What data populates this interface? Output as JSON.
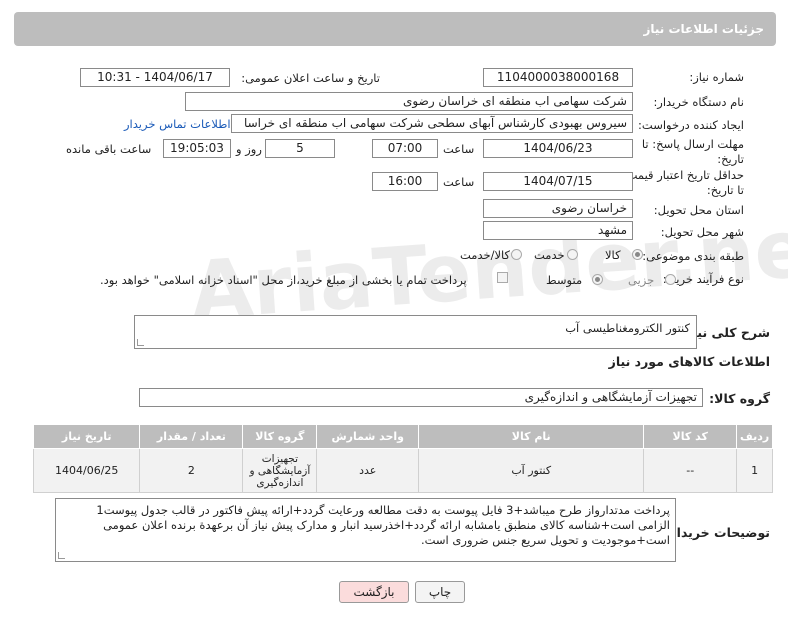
{
  "header": {
    "title": "جزئیات اطلاعات نیاز"
  },
  "fields": {
    "need_number_label": "شماره نیاز:",
    "need_number": "1104000038000168",
    "announce_label": "تاریخ و ساعت اعلان عمومی:",
    "announce_value": "1404/06/17 - 10:31",
    "buyer_org_label": "نام دستگاه خریدار:",
    "buyer_org": "شرکت سهامی اب منطقه ای خراسان رضوی",
    "creator_label": "ایجاد کننده درخواست:",
    "creator": "سیروس  بهبودی کارشناس آبهای سطحی شرکت سهامی اب منطقه ای خراسا",
    "contact_link": "اطلاعات تماس خریدار",
    "deadline_label_1": "مهلت ارسال پاسخ: تا",
    "deadline_label_2": "تاریخ:",
    "deadline_date": "1404/06/23",
    "time_label": "ساعت",
    "deadline_time": "07:00",
    "days_value": "5",
    "days_label": "روز و",
    "remaining_time": "19:05:03",
    "remaining_label": "ساعت باقی مانده",
    "price_valid_label_1": "حداقل تاریخ اعتبار قیمت:",
    "price_valid_label_2": "تا تاریخ:",
    "price_valid_date": "1404/07/15",
    "price_valid_time": "16:00",
    "province_label": "استان محل تحویل:",
    "province": "خراسان رضوی",
    "city_label": "شهر محل تحویل:",
    "city": "مشهد",
    "category_label": "طبقه بندی موضوعی:",
    "category_options": [
      "کالا",
      "خدمت",
      "کالا/خدمت"
    ],
    "process_label": "نوع فرآیند خرید :",
    "process_options": [
      "جزیی",
      "متوسط"
    ],
    "payment_note": "پرداخت تمام یا بخشی از مبلغ خرید،از محل \"اسناد خزانه اسلامی\" خواهد بود.",
    "general_desc_label": "شرح کلی نیاز:",
    "general_desc": "کنتور الکترومغناطیسی آب",
    "goods_info_label": "اطلاعات کالاهای مورد نیاز",
    "goods_group_label": "گروه کالا:",
    "goods_group": "تجهیزات آزمایشگاهی و اندازه‌گیری",
    "buyer_notes_label": "توضیحات خریدار:",
    "buyer_notes": "پرداخت مدتدارواز طرح میباشد+3 فایل پیوست به دقت مطالعه ورعایت گردد+ارائه پیش فاکتور در قالب جدول پیوست1 الزامی است+شناسه کالای منطبق یامشابه ارائه گردد+اخذرسید انبار و مدارک پیش نیاز آن برعهدة برنده اعلان عمومی است+موجودیت و تحویل سریع جنس ضروری است."
  },
  "table": {
    "headers": [
      "ردیف",
      "کد کالا",
      "نام کالا",
      "واحد شمارش",
      "گروه کالا",
      "تعداد / مقدار",
      "تاریخ نیاز"
    ],
    "rows": [
      [
        "1",
        "--",
        "کنتور آب",
        "عدد",
        "تجهیزات آزمایشگاهی و اندازه‌گیری",
        "2",
        "1404/06/25"
      ]
    ]
  },
  "buttons": {
    "print": "چاپ",
    "back": "بازگشت"
  },
  "watermark": "AriaTender.net"
}
